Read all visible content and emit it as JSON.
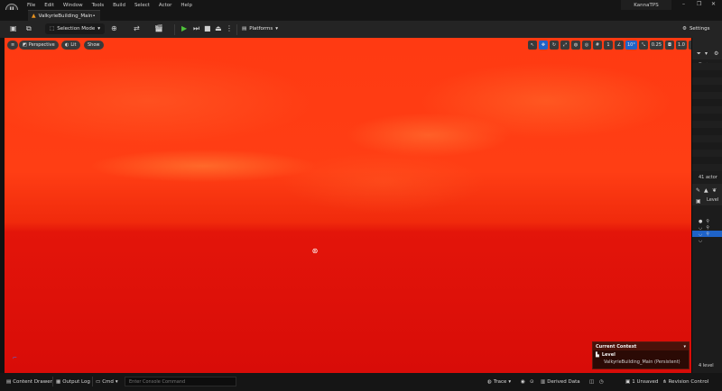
{
  "app": {
    "logo_text": "U",
    "project_name": "KannaTPS",
    "window_controls": {
      "minimize": "–",
      "maximize": "❐",
      "close": "✕"
    }
  },
  "menu": [
    "File",
    "Edit",
    "Window",
    "Tools",
    "Build",
    "Select",
    "Actor",
    "Help"
  ],
  "tab": {
    "label": "ValkyrieBuilding_Main•",
    "icon": "level-icon"
  },
  "toolbar": {
    "selection_mode": "Selection Mode",
    "platforms": "Platforms",
    "settings": "Settings"
  },
  "viewport": {
    "perspective": "Perspective",
    "lit": "Lit",
    "show": "Show",
    "fov": "10°",
    "scale": "0.25",
    "camera_speed": "1.0",
    "grid_count": "1",
    "sky_colors": [
      "#ff3e14",
      "#d80c08"
    ]
  },
  "context_panel": {
    "title": "Current Context",
    "level_label": "Level",
    "level_name": "ValkyrieBuilding_Main (Persistent)"
  },
  "outliner": {
    "actor_count": "41 actor",
    "levels_label": "Level",
    "level_count": "4 level"
  },
  "statusbar": {
    "content_drawer": "Content Drawer",
    "output_log": "Output Log",
    "cmd": "Cmd",
    "console_placeholder": "Enter Console Command",
    "trace": "Trace",
    "derived_data": "Derived Data",
    "unsaved": "1 Unsaved",
    "revision_control": "Revision Control"
  }
}
